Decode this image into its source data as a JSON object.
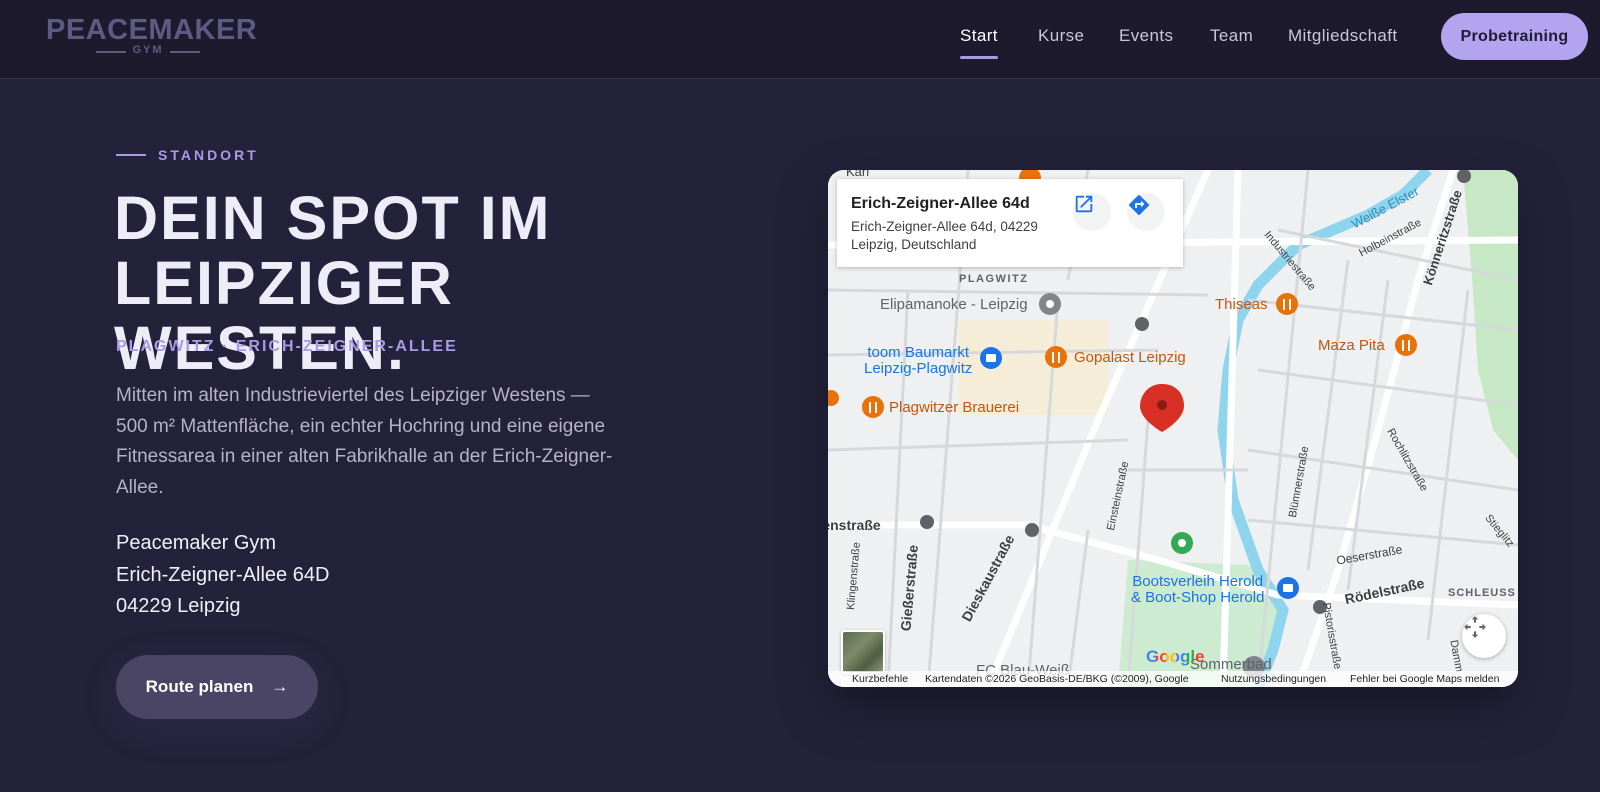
{
  "header": {
    "logo_main": "PEACEMAKER",
    "logo_sub": "GYM",
    "nav": [
      {
        "label": "Start",
        "active": true
      },
      {
        "label": "Kurse",
        "active": false
      },
      {
        "label": "Events",
        "active": false
      },
      {
        "label": "Team",
        "active": false
      },
      {
        "label": "Mitgliedschaft",
        "active": false
      }
    ],
    "cta_label": "Probetraining"
  },
  "section": {
    "eyebrow": "STANDORT",
    "headline_line1": "DEIN SPOT IM",
    "headline_line2": "LEIPZIGER WESTEN.",
    "subline": "PLAGWITZ · ERICH-ZEIGNER-ALLEE",
    "description": "Mitten im alten Industrieviertel des Leipziger Westens — 500 m² Mattenfläche, ein echter Hochring und eine eigene Fitnessarea in einer alten Fabrikhalle an der Erich-Zeigner-Allee.",
    "address_name": "Peacemaker Gym",
    "address_street": "Erich-Zeigner-Allee 64D",
    "address_city": "04229 Leipzig",
    "route_button": "Route planen",
    "route_arrow": "→"
  },
  "map": {
    "info_title": "Erich-Zeigner-Allee 64d",
    "info_address_line1": "Erich-Zeigner-Allee 64d, 04229",
    "info_address_line2": "Leipzig, Deutschland",
    "district_label": "PLAGWITZ",
    "pois": [
      {
        "name": "Elipamanoke - Leipzig",
        "kind": "place"
      },
      {
        "name": "toom Baumarkt",
        "name2": "Leipzig-Plagwitz",
        "kind": "shop"
      },
      {
        "name": "Gopalast Leipzig",
        "kind": "restaurant"
      },
      {
        "name": "Plagwitzer Brauerei",
        "kind": "restaurant"
      },
      {
        "name": "Thiseas",
        "kind": "restaurant"
      },
      {
        "name": "Maza Pita",
        "kind": "restaurant"
      },
      {
        "name": "Bootsverleih Herold",
        "name2": "& Boot-Shop Herold",
        "kind": "shop"
      },
      {
        "name": "Sommerbad",
        "kind": "place"
      },
      {
        "name": "FC Blau-Weiß",
        "kind": "place"
      }
    ],
    "streets": [
      "Weiße Elster",
      "Holbeinstraße",
      "Industriestraße",
      "Könneritzstraße",
      "Einsteinstraße",
      "Dieskaustraße",
      "Gießerstraße",
      "Klingenstraße",
      "Blümnerstraße",
      "Rochlitzstraße",
      "Oeserstraße",
      "Rödelstraße",
      "Pistorisstraße",
      "Stieglitz",
      "SCHLEUSS",
      "Antonienstraße",
      "Damm",
      "Karl"
    ],
    "google_logo": "Google",
    "footer_shortcuts": "Kurzbefehle",
    "footer_data": "Kartendaten ©2026 GeoBasis-DE/BKG (©2009), Google",
    "footer_terms": "Nutzungsbedingungen",
    "footer_report": "Fehler bei Google Maps melden",
    "colors": {
      "road": "#ffffff",
      "water": "#8ed4ec",
      "park": "#c7e8c4",
      "restaurant": "#e8710a",
      "shop": "#1a73e8",
      "marker": "#d93025"
    }
  },
  "colors": {
    "background": "#24223a",
    "header": "#1c1a2c",
    "accent": "#a99ae6",
    "cta": "#b2a4ee"
  }
}
